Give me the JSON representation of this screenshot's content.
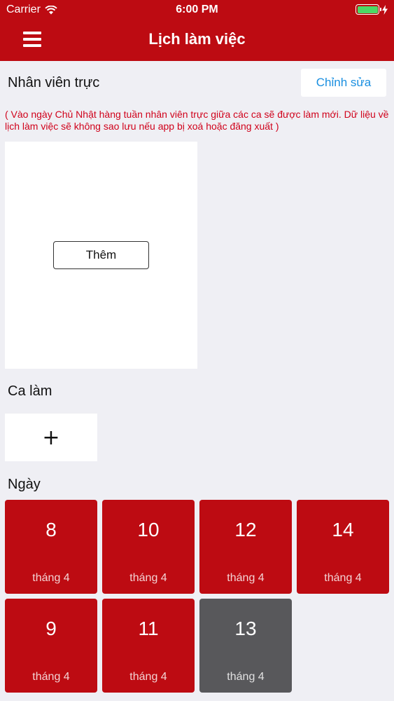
{
  "status_bar": {
    "carrier": "Carrier",
    "time": "6:00 PM"
  },
  "nav": {
    "title": "Lịch làm việc"
  },
  "staff_section": {
    "title": "Nhân viên trực",
    "edit_label": "Chỉnh sửa",
    "notice": "( Vào ngày Chủ Nhật hàng tuần nhân viên trực giữa các ca sẽ được làm mới. Dữ liệu về lịch làm việc sẽ không sao lưu nếu app bị xoá hoặc đăng xuất )",
    "add_label": "Thêm"
  },
  "shift_section": {
    "title": "Ca làm",
    "add_label": "+"
  },
  "day_section": {
    "title": "Ngày",
    "days": [
      {
        "day": "8",
        "month": "tháng 4"
      },
      {
        "day": "10",
        "month": "tháng 4"
      },
      {
        "day": "12",
        "month": "tháng 4"
      },
      {
        "day": "14",
        "month": "tháng 4"
      },
      {
        "day": "9",
        "month": "tháng 4"
      },
      {
        "day": "11",
        "month": "tháng 4"
      },
      {
        "day": "13",
        "month": "tháng 4"
      }
    ]
  },
  "colors": {
    "brand": "#bd0b12",
    "inactive_day": "#58585b",
    "notice": "#d0021b",
    "link": "#1a8fe0",
    "background": "#efeff4"
  }
}
